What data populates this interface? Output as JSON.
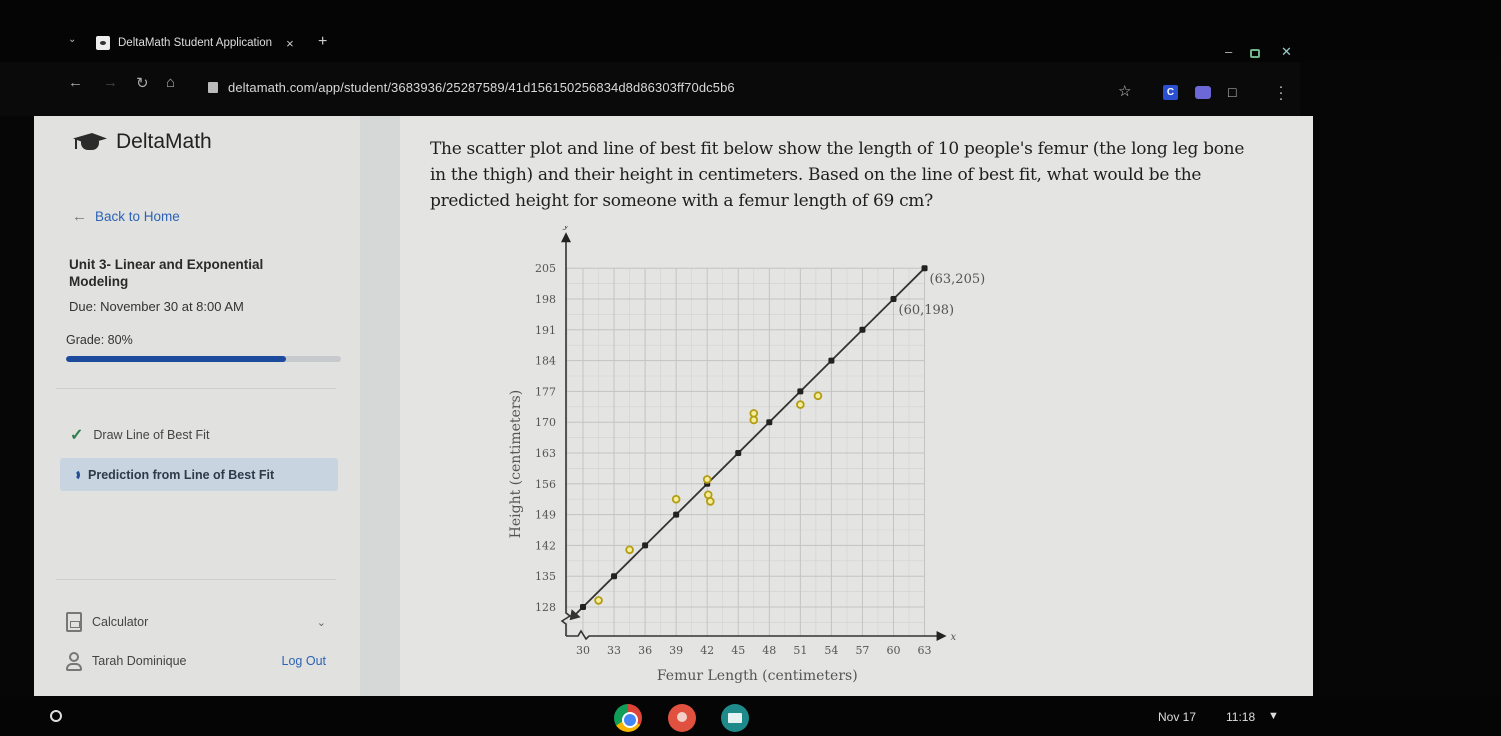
{
  "browser": {
    "tab_title": "DeltaMath Student Application",
    "tab_close": "×",
    "new_tab": "+",
    "url": "deltamath.com/app/student/3683936/25287589/41d156150256834d8d86303ff70dc5b6",
    "icons": [
      "chevron-down-icon",
      "favicon",
      "close-icon",
      "plus-icon",
      "back-icon",
      "forward-icon",
      "reload-icon",
      "home-icon",
      "site-info-icon",
      "star-icon",
      "extension-c-icon",
      "extension-puzzle-icon",
      "extensions-icon",
      "menu-icon",
      "minimize-icon",
      "restore-icon",
      "close-window-icon"
    ]
  },
  "sidebar": {
    "brand": "DeltaMath",
    "back_label": "Back to Home",
    "unit_title": "Unit 3- Linear and Exponential Modeling",
    "due": "Due: November 30 at 8:00 AM",
    "grade_label": "Grade: 80%",
    "grade_percent": 80,
    "skills": [
      {
        "label": "Draw Line of Best Fit",
        "status": "complete"
      },
      {
        "label": "Prediction from Line of Best Fit",
        "status": "in-progress",
        "active": true
      }
    ],
    "calculator_label": "Calculator",
    "user_name": "Tarah Dominique",
    "logout_label": "Log Out"
  },
  "question": {
    "text": "The scatter plot and line of best fit below show the length of 10 people's femur (the long leg bone in the thigh) and their height in centimeters. Based on the line of best fit, what would be the predicted height for someone with a femur length of 69 cm?"
  },
  "chart_data": {
    "type": "scatter",
    "title": "",
    "xlabel": "Femur Length (centimeters)",
    "ylabel": "Height (centimeters)",
    "x_axis_var": "x",
    "y_axis_var": "y",
    "xlim": [
      27,
      64
    ],
    "ylim": [
      121,
      207
    ],
    "x_ticks": [
      30,
      33,
      36,
      39,
      42,
      45,
      48,
      51,
      54,
      57,
      60,
      63
    ],
    "y_ticks": [
      128,
      135,
      142,
      149,
      156,
      163,
      170,
      177,
      184,
      191,
      198,
      205
    ],
    "grid": true,
    "axis_break": true,
    "series": [
      {
        "name": "Data points",
        "kind": "scatter",
        "color": "#e8d21c",
        "points": [
          [
            31.5,
            129.5
          ],
          [
            34.5,
            141
          ],
          [
            39,
            152.5
          ],
          [
            42,
            157
          ],
          [
            42.1,
            153.5
          ],
          [
            42.3,
            152
          ],
          [
            46.5,
            172
          ],
          [
            46.5,
            170.5
          ],
          [
            51,
            174
          ],
          [
            52.7,
            176
          ]
        ]
      },
      {
        "name": "Line of best fit",
        "kind": "line",
        "color": "#333333",
        "points": [
          [
            30,
            128
          ],
          [
            33,
            135
          ],
          [
            36,
            142
          ],
          [
            39,
            149
          ],
          [
            42,
            156
          ],
          [
            45,
            163
          ],
          [
            48,
            170
          ],
          [
            51,
            177
          ],
          [
            54,
            184
          ],
          [
            57,
            191
          ],
          [
            60,
            198
          ],
          [
            63,
            205
          ]
        ]
      }
    ],
    "annotations": [
      {
        "text": "(63,205)",
        "x": 63,
        "y": 205
      },
      {
        "text": "(60,198)",
        "x": 60,
        "y": 198
      }
    ]
  },
  "taskbar": {
    "date": "Nov 17",
    "time": "11:18",
    "apps": [
      "chrome-icon",
      "palette-icon",
      "classroom-icon"
    ]
  }
}
